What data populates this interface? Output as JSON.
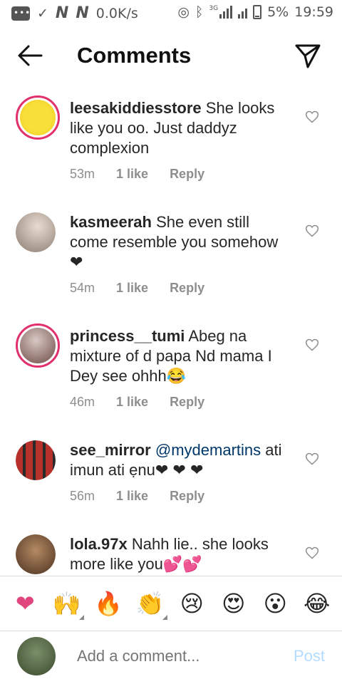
{
  "status_bar": {
    "speed": "0.0K/s",
    "battery": "5%",
    "time": "19:59",
    "network": "3G"
  },
  "header": {
    "title": "Comments",
    "back_icon": "arrow-left-icon",
    "share_icon": "paper-plane-icon"
  },
  "comments": [
    {
      "username": "leesakiddiesstore",
      "text": "She looks like you oo. Just daddyz complexion",
      "time": "53m",
      "likes": "1 like",
      "reply": "Reply",
      "avatar_color": "#f5d21a"
    },
    {
      "username": "kasmeerah",
      "text": "She even still come resemble you somehow❤",
      "time": "54m",
      "likes": "1 like",
      "reply": "Reply",
      "avatar_color": "#b9a89a"
    },
    {
      "username": "princess__tumi",
      "text": "Abeg na mixture of d papa Nd mama I Dey see ohhh😂",
      "time": "46m",
      "likes": "1 like",
      "reply": "Reply",
      "avatar_color": "#a6837d"
    },
    {
      "username": "see_mirror",
      "mention": "@mydemartins",
      "text": "ati imun ati ẹnu❤ ❤ ❤",
      "time": "56m",
      "likes": "1 like",
      "reply": "Reply",
      "avatar_color": "#b5312a"
    },
    {
      "username": "lola.97x",
      "text": "Nahh lie.. she looks more like you💕💕",
      "avatar_color": "#7a5a3a"
    }
  ],
  "emoji_bar": [
    "❤",
    "🙌",
    "🔥",
    "👏",
    "😢",
    "😍",
    "😮",
    "😂"
  ],
  "add_comment": {
    "placeholder": "Add a comment...",
    "post_label": "Post"
  },
  "colors": {
    "accent_ring": "#e1306c",
    "post_disabled": "#b3dbff",
    "mention": "#00376b"
  }
}
